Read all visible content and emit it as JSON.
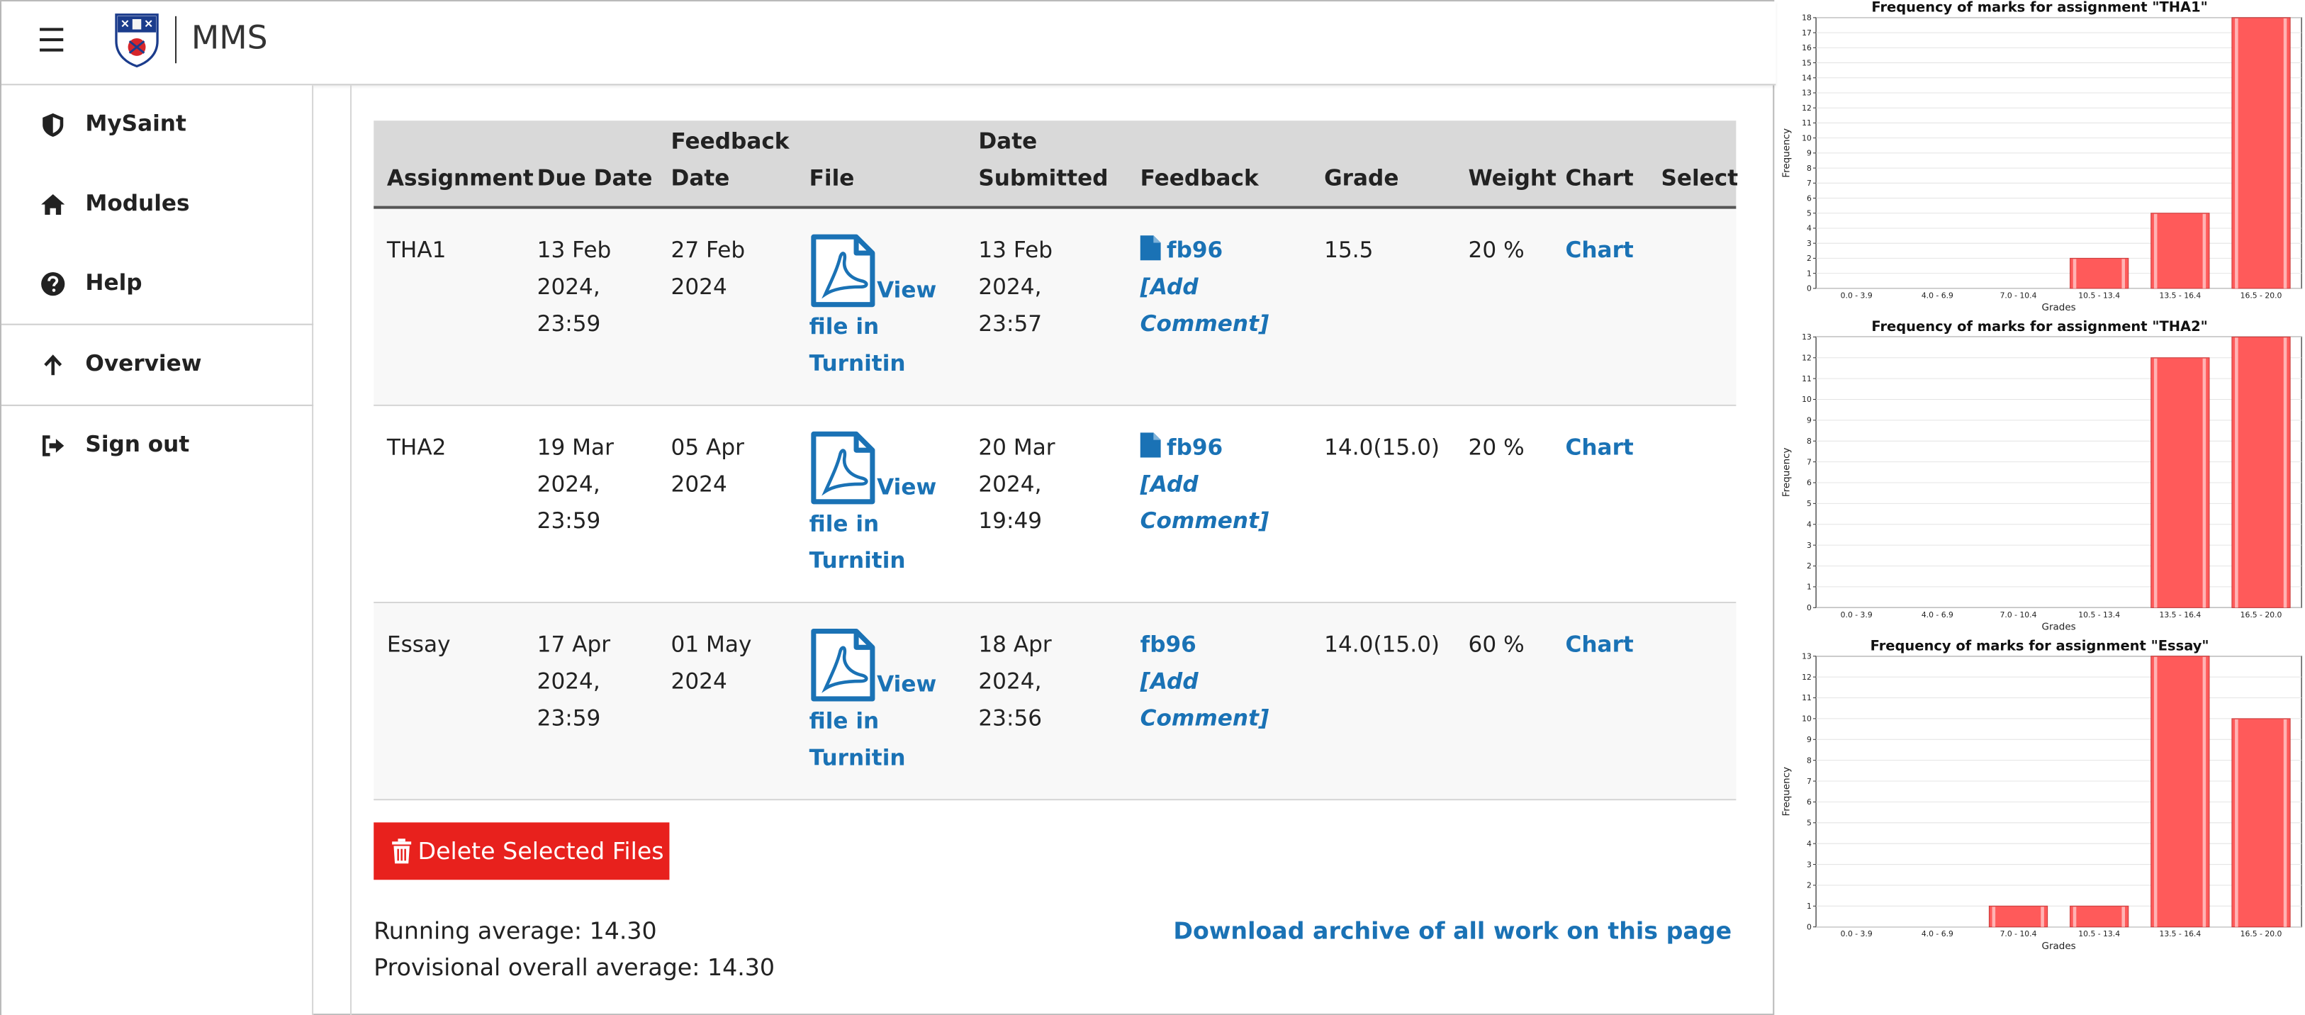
{
  "header": {
    "brand": "MMS"
  },
  "sidebar": {
    "items": [
      {
        "label": "MySaint",
        "icon": "shield-icon"
      },
      {
        "label": "Modules",
        "icon": "home-icon"
      },
      {
        "label": "Help",
        "icon": "question-circle-icon"
      },
      {
        "label": "Overview",
        "icon": "arrow-up-icon"
      },
      {
        "label": "Sign out",
        "icon": "sign-out-icon"
      }
    ]
  },
  "table": {
    "headers": {
      "assignment": "Assignment",
      "due_date": "Due Date",
      "feedback_date_1": "Feedback",
      "feedback_date_2": "Date",
      "file": "File",
      "date_submitted_1": "Date",
      "date_submitted_2": "Submitted",
      "feedback": "Feedback",
      "grade": "Grade",
      "weight": "Weight",
      "chart": "Chart",
      "select": "Select"
    },
    "rows": [
      {
        "assignment": "THA1",
        "due": [
          "13 Feb",
          "2024,",
          "23:59"
        ],
        "feedback_date": [
          "27 Feb",
          "2024"
        ],
        "file_link": [
          "View",
          "file in",
          "Turnitin"
        ],
        "submitted": [
          "13 Feb",
          "2024,",
          "23:57"
        ],
        "feedback_file": "fb96",
        "feedback_comment": [
          "[Add",
          "Comment]"
        ],
        "grade": "15.5",
        "weight": "20 %",
        "chart": "Chart"
      },
      {
        "assignment": "THA2",
        "due": [
          "19 Mar",
          "2024,",
          "23:59"
        ],
        "feedback_date": [
          "05 Apr",
          "2024"
        ],
        "file_link": [
          "View",
          "file in",
          "Turnitin"
        ],
        "submitted": [
          "20 Mar",
          "2024,",
          "19:49"
        ],
        "feedback_file": "fb96",
        "feedback_comment": [
          "[Add",
          "Comment]"
        ],
        "grade": "14.0(15.0)",
        "weight": "20 %",
        "chart": "Chart"
      },
      {
        "assignment": "Essay",
        "due": [
          "17 Apr",
          "2024,",
          "23:59"
        ],
        "feedback_date": [
          "01 May",
          "2024"
        ],
        "file_link": [
          "View",
          "file in",
          "Turnitin"
        ],
        "submitted": [
          "18 Apr",
          "2024,",
          "23:56"
        ],
        "feedback_file": "fb96",
        "feedback_comment": [
          "[Add",
          "Comment]"
        ],
        "grade": "14.0(15.0)",
        "weight": "60 %",
        "chart": "Chart"
      }
    ]
  },
  "actions": {
    "delete_label": "Delete Selected Files",
    "running_average": "Running average: 14.30",
    "overall_average": "Provisional overall average: 14.30",
    "download_label": "Download archive of all work on this page"
  },
  "colors": {
    "accent": "#1a72b5",
    "danger": "#e8211d",
    "bar": "#ff5a5a"
  },
  "chart_data": [
    {
      "type": "bar",
      "title": "Frequency of marks for assignment \"THA1\"",
      "xlabel": "Grades",
      "ylabel": "Frequency",
      "categories": [
        "0.0 - 3.9",
        "4.0 - 6.9",
        "7.0 - 10.4",
        "10.5 - 13.4",
        "13.5 - 16.4",
        "16.5 - 20.0"
      ],
      "values": [
        0,
        0,
        0,
        2,
        5,
        18
      ],
      "ylim": [
        0,
        18
      ],
      "yticks": [
        0,
        1,
        2,
        3,
        4,
        5,
        6,
        7,
        8,
        9,
        10,
        11,
        12,
        13,
        14,
        15,
        16,
        17,
        18
      ],
      "grid": true
    },
    {
      "type": "bar",
      "title": "Frequency of marks for assignment \"THA2\"",
      "xlabel": "Grades",
      "ylabel": "Frequency",
      "categories": [
        "0.0 - 3.9",
        "4.0 - 6.9",
        "7.0 - 10.4",
        "10.5 - 13.4",
        "13.5 - 16.4",
        "16.5 - 20.0"
      ],
      "values": [
        0,
        0,
        0,
        0,
        12,
        13
      ],
      "ylim": [
        0,
        13
      ],
      "yticks": [
        0,
        1,
        2,
        3,
        4,
        5,
        6,
        7,
        8,
        9,
        10,
        11,
        12,
        13
      ],
      "grid": true
    },
    {
      "type": "bar",
      "title": "Frequency of marks for assignment \"Essay\"",
      "xlabel": "Grades",
      "ylabel": "Frequency",
      "categories": [
        "0.0 - 3.9",
        "4.0 - 6.9",
        "7.0 - 10.4",
        "10.5 - 13.4",
        "13.5 - 16.4",
        "16.5 - 20.0"
      ],
      "values": [
        0,
        0,
        1,
        1,
        13,
        10
      ],
      "ylim": [
        0,
        13
      ],
      "yticks": [
        0,
        1,
        2,
        3,
        4,
        5,
        6,
        7,
        8,
        9,
        10,
        11,
        12,
        13
      ],
      "grid": true
    }
  ]
}
